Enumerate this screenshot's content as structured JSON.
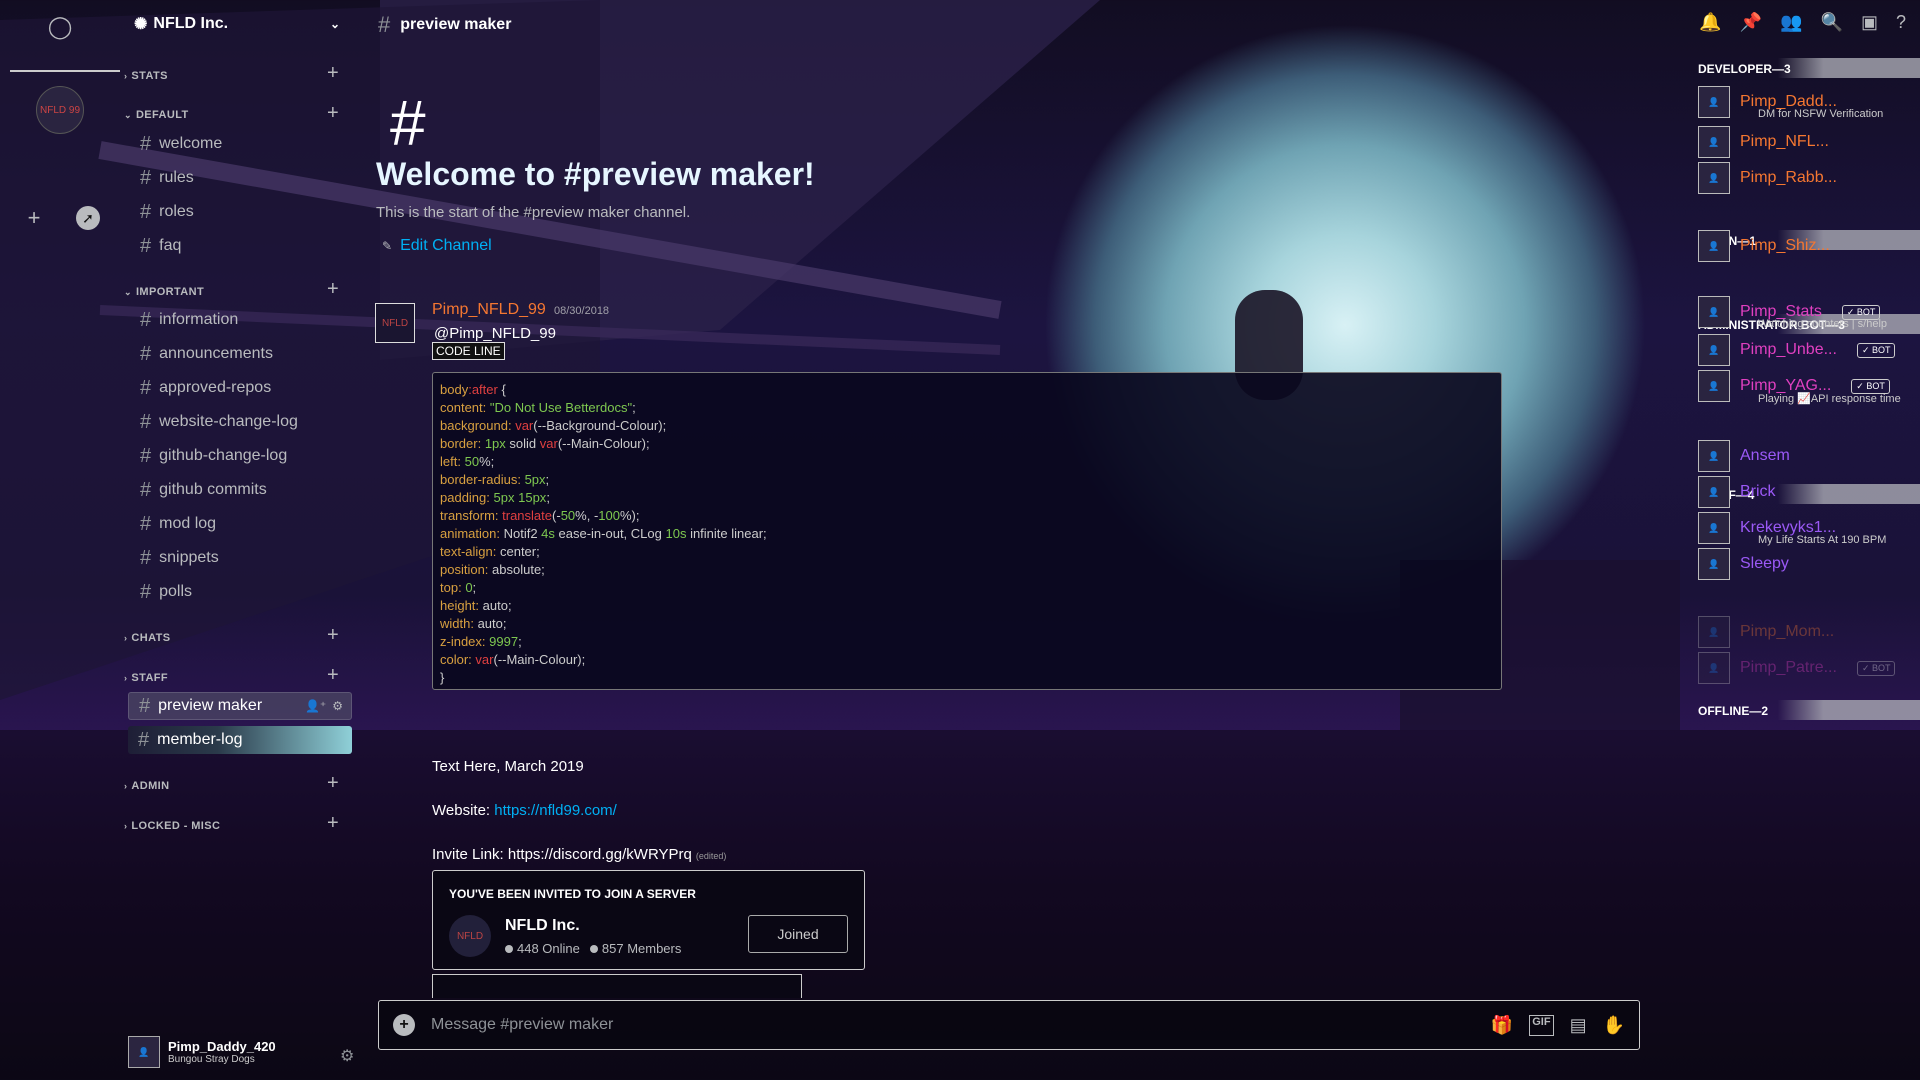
{
  "server": {
    "name": "NFLD Inc.",
    "logo_text": "NFLD 99"
  },
  "channel": {
    "name": "preview maker"
  },
  "categories": [
    {
      "label": "STATS"
    },
    {
      "label": "DEFAULT"
    },
    {
      "label": "IMPORTANT"
    },
    {
      "label": "CHATS"
    },
    {
      "label": "STAFF"
    },
    {
      "label": "ADMIN"
    },
    {
      "label": "LOCKED - MISC"
    }
  ],
  "channels": {
    "default": [
      "welcome",
      "rules",
      "roles",
      "faq"
    ],
    "important": [
      "information",
      "announcements",
      "approved-repos",
      "website-change-log",
      "github-change-log",
      "github commits",
      "mod log",
      "snippets",
      "polls"
    ],
    "staff": [
      "preview maker",
      "member-log"
    ]
  },
  "user": {
    "name": "Pimp_Daddy_420",
    "status": "Bungou Stray Dogs"
  },
  "welcome": {
    "title": "Welcome to #preview maker!",
    "subtitle": "This is the start of the #preview maker channel.",
    "edit_label": "Edit Channel"
  },
  "message": {
    "author": "Pimp_NFLD_99",
    "timestamp": "08/30/2018",
    "mention": "@Pimp_NFLD_99",
    "code_tag": "CODE LINE",
    "code": [
      "body:after {",
      "content: \"Do Not Use Betterdocs\";",
      "background: var(--Background-Colour);",
      "border: 1px solid var(--Main-Colour);",
      "left: 50%;",
      "border-radius: 5px;",
      "padding: 5px 15px;",
      "transform: translate(-50%, -100%);",
      "animation: Notif2 4s ease-in-out, CLog 10s infinite linear;",
      "text-align: center;",
      "position: absolute;",
      "top: 0;",
      "height: auto;",
      "width: auto;",
      "z-index: 9997;",
      "color: var(--Main-Colour);",
      "}"
    ],
    "text_here": "Text Here, March 2019",
    "website_label": "Website:",
    "website_url": "https://nfld99.com/",
    "invite_label": "Invite Link:",
    "invite_url": "https://discord.gg/kWRYPrq",
    "edited": "(edited)"
  },
  "invite": {
    "header": "YOU'VE BEEN INVITED TO JOIN A SERVER",
    "server": "NFLD Inc.",
    "online": "448 Online",
    "members": "857 Members",
    "button": "Joined"
  },
  "input": {
    "placeholder": "Message #preview maker"
  },
  "members": {
    "roles": [
      {
        "label": "DEVELOPER—3"
      },
      {
        "label": "ADMIN—1"
      },
      {
        "label": "ADMINISTRATOR BOT—3"
      },
      {
        "label": "STAFF—4"
      },
      {
        "label": "OFFLINE—2"
      }
    ],
    "list": [
      {
        "name": "Pimp_Dadd...",
        "sub": "DM for NSFW Verification",
        "color": "#f57731"
      },
      {
        "name": "Pimp_NFL...",
        "sub": "",
        "color": "#f57731"
      },
      {
        "name": "Pimp_Rabb...",
        "sub": "",
        "color": "#f57731"
      },
      {
        "name": "Pimp_Shiz...",
        "sub": "",
        "color": "#f57731"
      },
      {
        "name": "Pimp_Stats",
        "sub": "Watching counters | s/help",
        "color": "#e040c0",
        "bot": "✓ BOT"
      },
      {
        "name": "Pimp_Unbe...",
        "sub": "",
        "color": "#e040c0",
        "bot": "✓ BOT"
      },
      {
        "name": "Pimp_YAG...",
        "sub": "Playing 📈API response time",
        "color": "#e040c0",
        "bot": "✓ BOT"
      },
      {
        "name": "Ansem",
        "sub": "",
        "color": "#9b59f6"
      },
      {
        "name": "Brick",
        "sub": "",
        "color": "#9b59f6"
      },
      {
        "name": "Krekevyks1...",
        "sub": "My Life Starts At 190 BPM",
        "color": "#9b59f6"
      },
      {
        "name": "Sleepy",
        "sub": "",
        "color": "#9b59f6"
      },
      {
        "name": "Pimp_Mom...",
        "sub": "",
        "color": "#f57731"
      },
      {
        "name": "Pimp_Patre...",
        "sub": "",
        "color": "#e040c0",
        "bot": "✓ BOT"
      }
    ]
  }
}
